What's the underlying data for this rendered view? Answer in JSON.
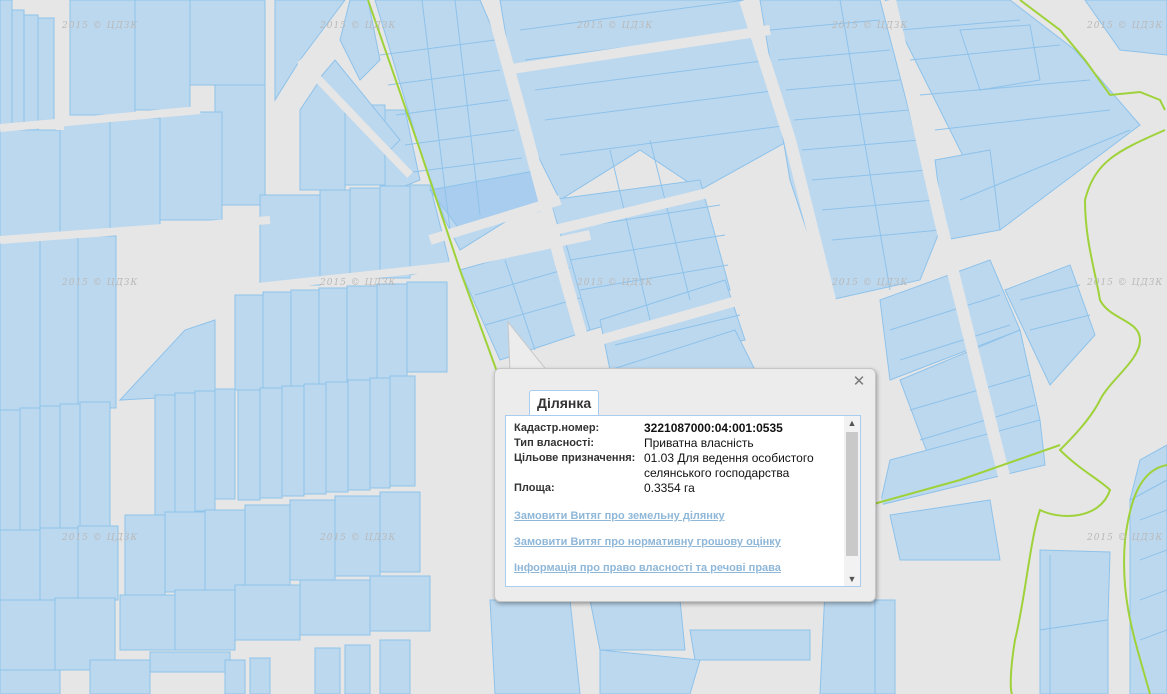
{
  "map": {
    "watermark": "2015 © ЦДЗК",
    "colors": {
      "background": "#e6e6e6",
      "parcel_fill": "#bcd8ef",
      "parcel_stroke": "#8ec2ea",
      "boundary": "#9fd23a"
    }
  },
  "popup": {
    "tab_label": "Ділянка",
    "close_icon": "close-icon",
    "fields": [
      {
        "label": "Кадастр.номер:",
        "value": "3221087000:04:001:0535"
      },
      {
        "label": "Тип власності:",
        "value": "Приватна власність"
      },
      {
        "label": "Цільове призначення:",
        "value": "01.03 Для ведення особистого селянського господарства"
      },
      {
        "label": "Площа:",
        "value": "0.3354 га"
      }
    ],
    "links": [
      "Замовити Витяг про земельну ділянку",
      "Замовити Витяг про нормативну грошову оцінку",
      "Інформація про право власності та речові права"
    ]
  }
}
